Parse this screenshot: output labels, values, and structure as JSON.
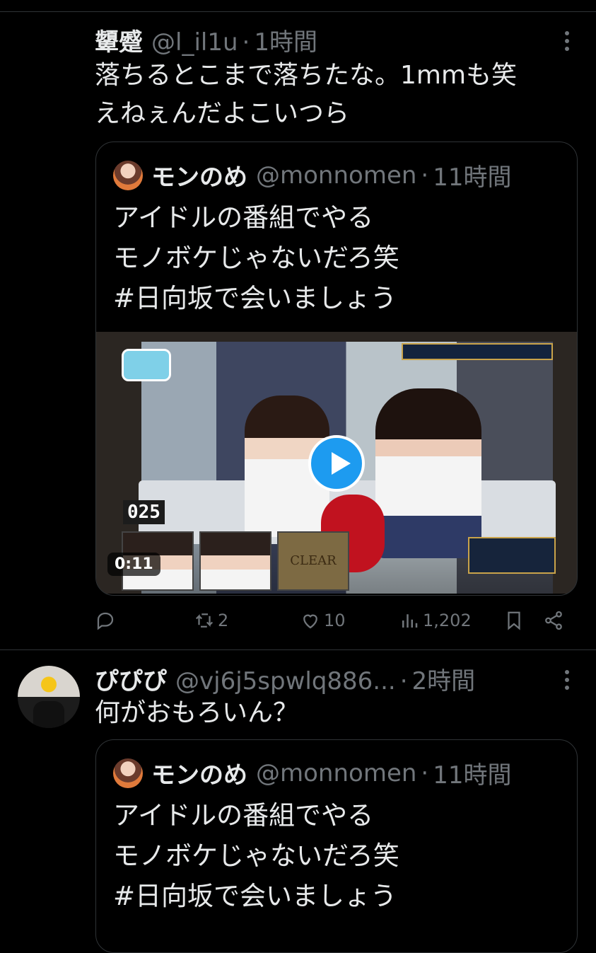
{
  "tweet1": {
    "name": "顰蹙",
    "handle": "@l_il1u",
    "separator": "·",
    "time": "1時間",
    "text_line1": "落ちるとこまで落ちたな。1mmも笑",
    "text_line2": "えねぇんだよこいつら",
    "quote": {
      "name": "モンのめ",
      "handle": "@monnomen",
      "separator": "·",
      "time": "11時間",
      "line1": "アイドルの番組でやる",
      "line2": "モノボケじゃないだろ笑",
      "line3": "#日向坂で会いましょう",
      "video": {
        "duration": "0:11",
        "counter": "025",
        "clear_label": "CLEAR"
      }
    },
    "actions": {
      "reply_count": "",
      "retweet_count": "2",
      "like_count": "10",
      "view_count": "1,202"
    }
  },
  "tweet2": {
    "name": "ぴぴぴ",
    "handle": "@vj6j5spwlq886...",
    "separator": "·",
    "time": "2時間",
    "text": "何がおもろいん？",
    "quote": {
      "name": "モンのめ",
      "handle": "@monnomen",
      "separator": "·",
      "time": "11時間",
      "line1": "アイドルの番組でやる",
      "line2": "モノボケじゃないだろ笑",
      "line3": "#日向坂で会いましょう"
    }
  },
  "colors": {
    "background": "#000000",
    "text": "#e7e9ea",
    "secondary": "#71767b",
    "border": "#2f3336",
    "accent": "#1d9bf0"
  },
  "icons": [
    "more-icon",
    "reply-icon",
    "retweet-icon",
    "like-icon",
    "views-icon",
    "bookmark-icon",
    "share-icon",
    "play-icon"
  ]
}
